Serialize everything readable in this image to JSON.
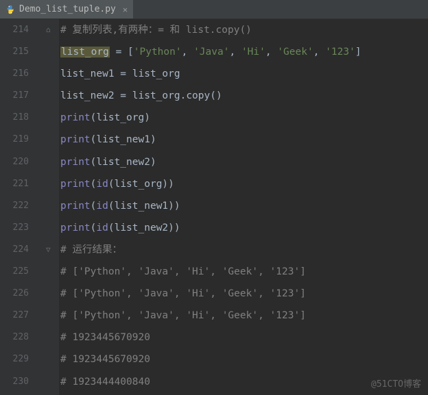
{
  "tab": {
    "filename": "Demo_list_tuple.py",
    "icon": "python-file-icon"
  },
  "gutter": {
    "start": 214,
    "end": 230
  },
  "code": {
    "lines": [
      [
        {
          "t": "comment",
          "v": "# 复制列表,有两种：= 和 list.copy()"
        }
      ],
      [
        {
          "t": "hl",
          "v": "list_org"
        },
        {
          "t": "op",
          "v": " = ["
        },
        {
          "t": "str",
          "v": "'Python'"
        },
        {
          "t": "op",
          "v": ", "
        },
        {
          "t": "str",
          "v": "'Java'"
        },
        {
          "t": "op",
          "v": ", "
        },
        {
          "t": "str",
          "v": "'Hi'"
        },
        {
          "t": "op",
          "v": ", "
        },
        {
          "t": "str",
          "v": "'Geek'"
        },
        {
          "t": "op",
          "v": ", "
        },
        {
          "t": "str",
          "v": "'123'"
        },
        {
          "t": "op",
          "v": "]"
        }
      ],
      [
        {
          "t": "plain",
          "v": "list_new1 = list_org"
        }
      ],
      [
        {
          "t": "plain",
          "v": "list_new2 = list_org.copy()"
        }
      ],
      [
        {
          "t": "builtin",
          "v": "print"
        },
        {
          "t": "op",
          "v": "(list_org)"
        }
      ],
      [
        {
          "t": "builtin",
          "v": "print"
        },
        {
          "t": "op",
          "v": "(list_new1)"
        }
      ],
      [
        {
          "t": "builtin",
          "v": "print"
        },
        {
          "t": "op",
          "v": "(list_new2)"
        }
      ],
      [
        {
          "t": "builtin",
          "v": "print"
        },
        {
          "t": "op",
          "v": "("
        },
        {
          "t": "builtin",
          "v": "id"
        },
        {
          "t": "op",
          "v": "(list_org))"
        }
      ],
      [
        {
          "t": "builtin",
          "v": "print"
        },
        {
          "t": "op",
          "v": "("
        },
        {
          "t": "builtin",
          "v": "id"
        },
        {
          "t": "op",
          "v": "(list_new1))"
        }
      ],
      [
        {
          "t": "builtin",
          "v": "print"
        },
        {
          "t": "op",
          "v": "("
        },
        {
          "t": "builtin",
          "v": "id"
        },
        {
          "t": "op",
          "v": "(list_new2))"
        }
      ],
      [
        {
          "t": "comment",
          "v": "# 运行结果："
        }
      ],
      [
        {
          "t": "comment",
          "v": "# ['Python', 'Java', 'Hi', 'Geek', '123']"
        }
      ],
      [
        {
          "t": "comment",
          "v": "# ['Python', 'Java', 'Hi', 'Geek', '123']"
        }
      ],
      [
        {
          "t": "comment",
          "v": "# ['Python', 'Java', 'Hi', 'Geek', '123']"
        }
      ],
      [
        {
          "t": "comment",
          "v": "# 1923445670920"
        }
      ],
      [
        {
          "t": "comment",
          "v": "# 1923445670920"
        }
      ],
      [
        {
          "t": "comment",
          "v": "# 1923444400840"
        }
      ]
    ]
  },
  "fold_markers": [
    {
      "line_index": 0,
      "glyph": "⌂"
    },
    {
      "line_index": 10,
      "glyph": "▽"
    }
  ],
  "watermark": "@51CTO博客"
}
